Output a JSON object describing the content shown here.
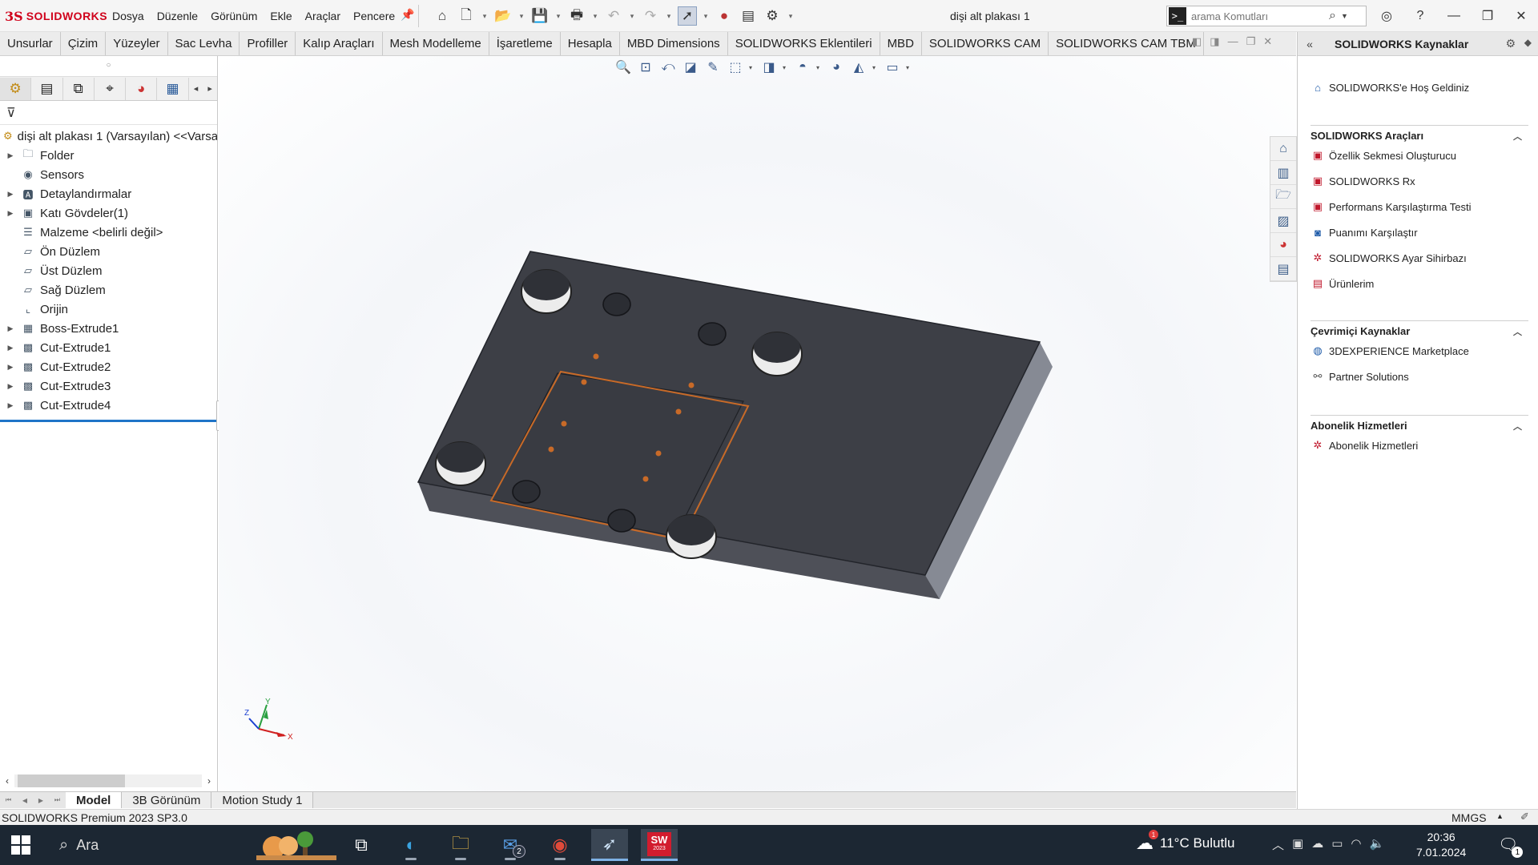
{
  "app": {
    "brand": "SOLIDWORKS",
    "brand_mark": "3S",
    "doc_title": "dişi alt plakası 1"
  },
  "menu": [
    "Dosya",
    "Düzenle",
    "Görünüm",
    "Ekle",
    "Araçlar",
    "Pencere"
  ],
  "search": {
    "placeholder": "arama Komutları"
  },
  "command_tabs": [
    "Unsurlar",
    "Çizim",
    "Yüzeyler",
    "Sac Levha",
    "Profiller",
    "Kalıp Araçları",
    "Mesh Modelleme",
    "İşaretleme",
    "Hesapla",
    "MBD Dimensions",
    "SOLIDWORKS Eklentileri",
    "MBD",
    "SOLIDWORKS CAM",
    "SOLIDWORKS CAM TBM"
  ],
  "feature_tree": {
    "root": "dişi alt plakası 1  (Varsayılan) <<Varsa",
    "items": [
      {
        "label": "Folder",
        "expandable": true,
        "icon": "folder-icon"
      },
      {
        "label": "Sensors",
        "expandable": false,
        "icon": "sensor-icon"
      },
      {
        "label": "Detaylandırmalar",
        "expandable": true,
        "icon": "annotation-icon"
      },
      {
        "label": "Katı Gövdeler(1)",
        "expandable": true,
        "icon": "solid-bodies-icon"
      },
      {
        "label": "Malzeme <belirli değil>",
        "expandable": false,
        "icon": "material-icon"
      },
      {
        "label": "Ön Düzlem",
        "expandable": false,
        "icon": "plane-icon"
      },
      {
        "label": "Üst Düzlem",
        "expandable": false,
        "icon": "plane-icon"
      },
      {
        "label": "Sağ Düzlem",
        "expandable": false,
        "icon": "plane-icon"
      },
      {
        "label": "Orijin",
        "expandable": false,
        "icon": "origin-icon"
      },
      {
        "label": "Boss-Extrude1",
        "expandable": true,
        "icon": "extrude-icon"
      },
      {
        "label": "Cut-Extrude1",
        "expandable": true,
        "icon": "cut-icon"
      },
      {
        "label": "Cut-Extrude2",
        "expandable": true,
        "icon": "cut-icon"
      },
      {
        "label": "Cut-Extrude3",
        "expandable": true,
        "icon": "cut-icon"
      },
      {
        "label": "Cut-Extrude4",
        "expandable": true,
        "icon": "cut-icon"
      }
    ]
  },
  "bottom_tabs": [
    "Model",
    "3B Görünüm",
    "Motion Study 1"
  ],
  "status": {
    "version": "SOLIDWORKS Premium 2023 SP3.0",
    "units": "MMGS"
  },
  "triad": {
    "x": "X",
    "y": "Y",
    "z": "Z"
  },
  "task_pane": {
    "title": "SOLIDWORKS Kaynaklar",
    "welcome": "SOLIDWORKS'e Hoş Geldiniz",
    "sections": [
      {
        "title": "SOLIDWORKS Araçları",
        "items": [
          "Özellik Sekmesi Oluşturucu",
          "SOLIDWORKS Rx",
          "Performans Karşılaştırma Testi",
          "Puanımı Karşılaştır",
          "SOLIDWORKS Ayar Sihirbazı",
          "Ürünlerim"
        ]
      },
      {
        "title": "Çevrimiçi Kaynaklar",
        "items": [
          "3DEXPERIENCE Marketplace",
          "Partner Solutions"
        ]
      },
      {
        "title": "Abonelik Hizmetleri",
        "items": [
          "Abonelik Hizmetleri"
        ]
      }
    ]
  },
  "taskbar": {
    "search_label": "Ara",
    "mail_badge": "2",
    "sw_year": "2023",
    "weather": "11°C  Bulutlu",
    "weather_badge": "1",
    "time": "20:36",
    "date": "7.01.2024",
    "notifications": "1"
  }
}
